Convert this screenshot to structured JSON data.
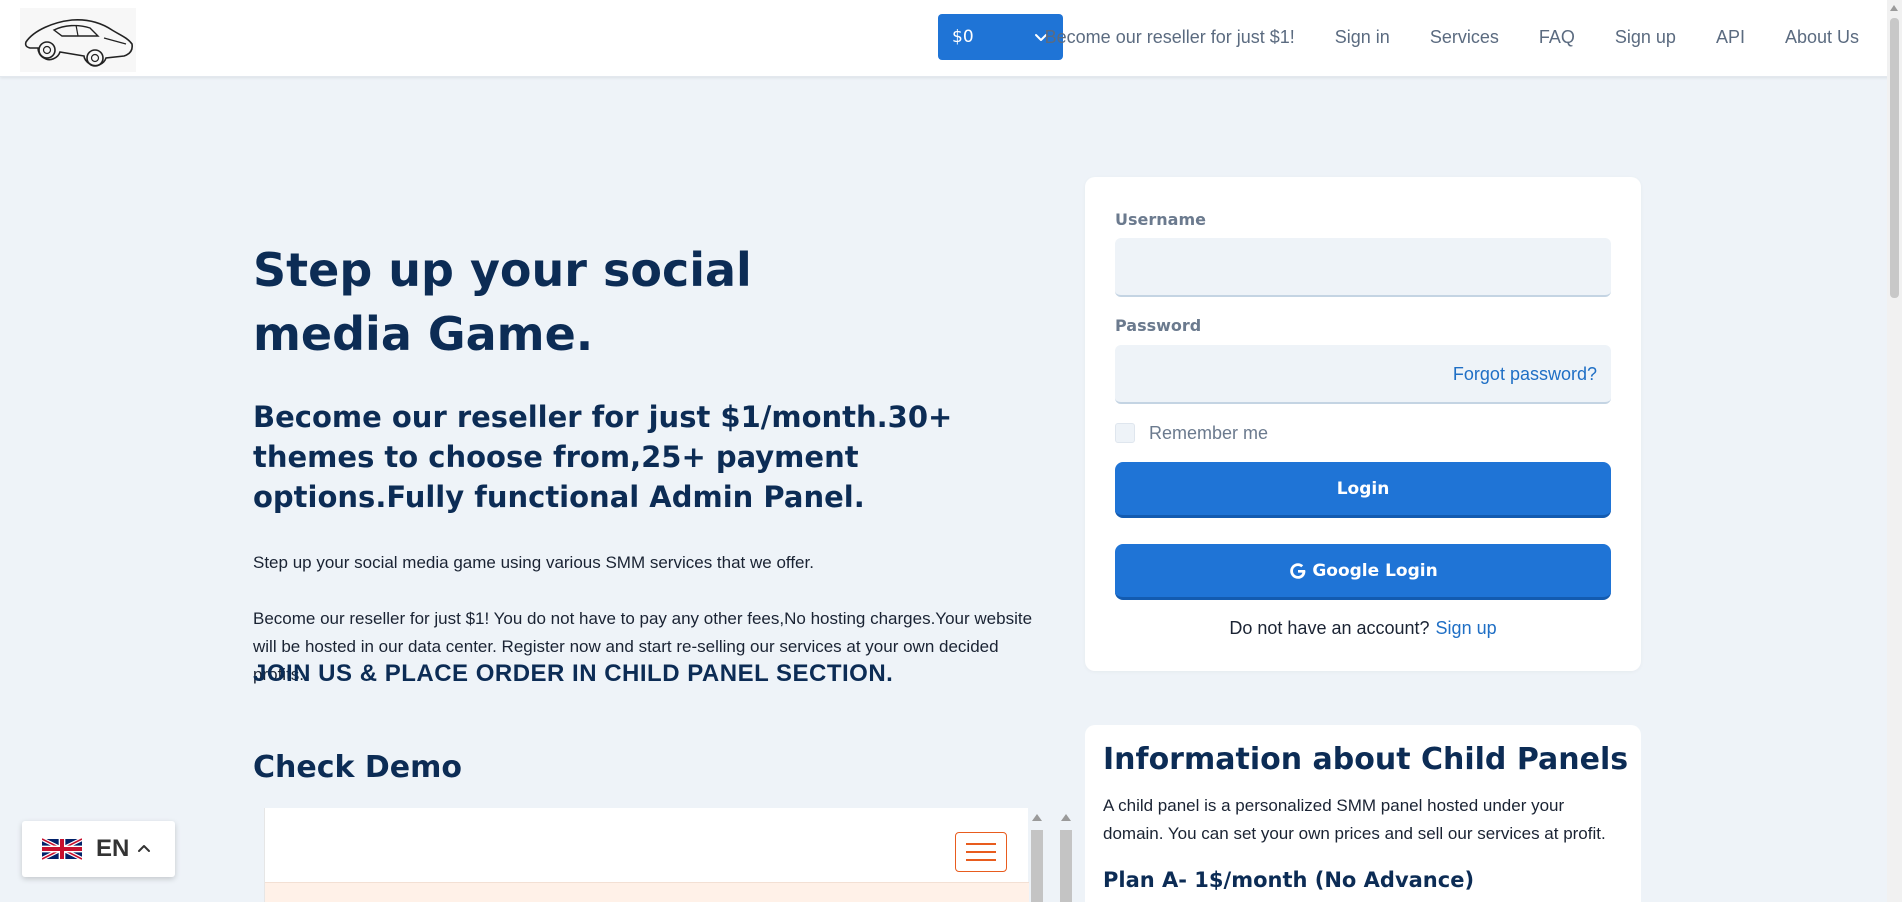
{
  "header": {
    "currency": "$0",
    "nav": [
      "Become our reseller for just $1!",
      "Sign in",
      "Services",
      "FAQ",
      "Sign up",
      "API",
      "About Us"
    ]
  },
  "hero": {
    "title": "Step up your social media Game.",
    "subtitle": "Become our reseller for just $1/month.30+ themes to choose from,25+ payment options.Fully functional Admin Panel.",
    "para1": "Step up your social media game using various SMM services that we offer.",
    "para2": "Become our reseller for just $1! You do not have to pay any other fees,No hosting charges.Your website will be hosted in our data center. Register now and start re-selling our services at your own decided profits.",
    "join": "JOIN US & PLACE ORDER IN CHILD PANEL SECTION.",
    "demo_title": "Check Demo"
  },
  "login": {
    "username_label": "Username",
    "username_value": "",
    "password_label": "Password",
    "password_value": "",
    "forgot": "Forgot password?",
    "remember": "Remember me",
    "login_button": "Login",
    "google_button": "Google Login",
    "no_account": "Do not have an account?",
    "signup_link": "Sign up"
  },
  "info": {
    "title": "Information about Child Panels",
    "text": "A child panel is a personalized SMM panel hosted under your domain. You can set your own prices and sell our services at profit.",
    "plan": "Plan A- 1$/month (No Advance)"
  },
  "language": {
    "code": "EN"
  },
  "colors": {
    "primary": "#1f74d6",
    "heading": "#0c2c55",
    "background": "#eef3f8",
    "link": "#1f6fc5",
    "accent": "#e85c1e"
  }
}
